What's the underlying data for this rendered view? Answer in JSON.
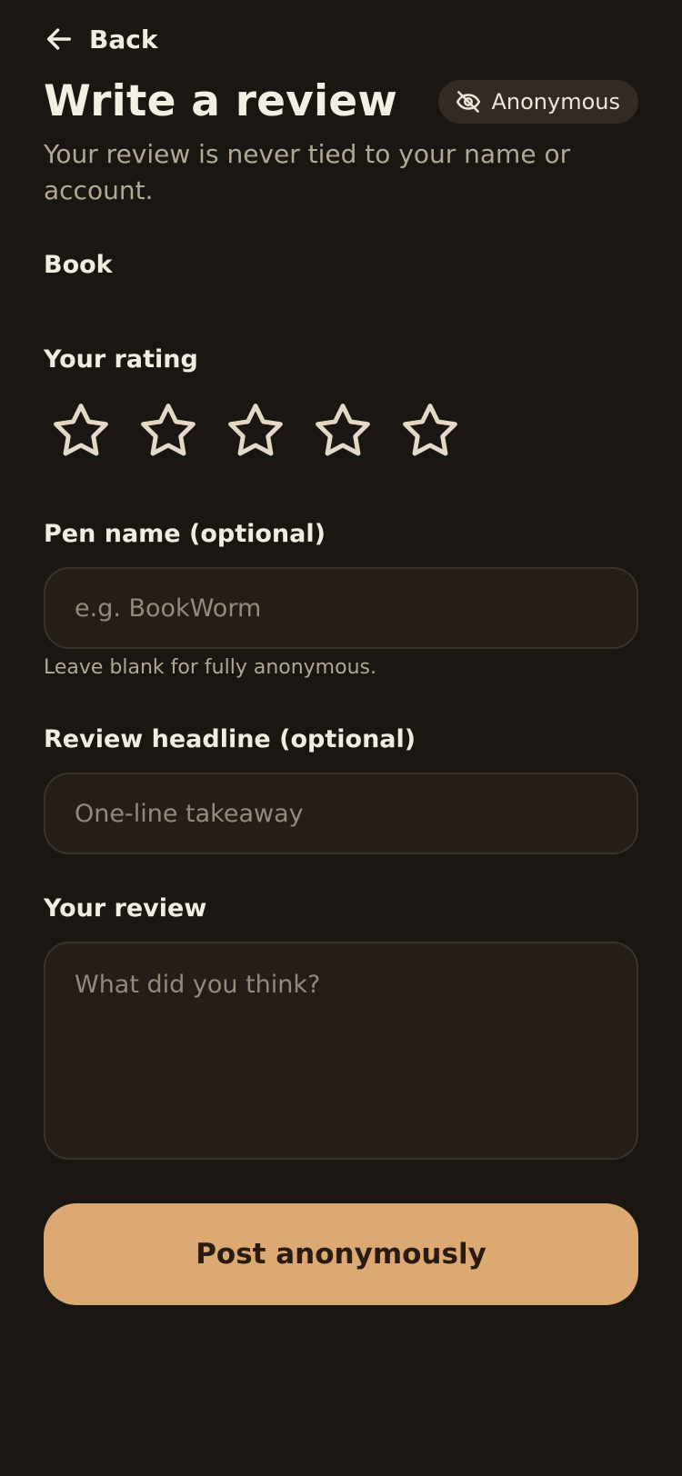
{
  "header": {
    "back_label": "Back",
    "title": "Write a review",
    "badge_label": "Anonymous",
    "subtitle": "Your review is never tied to your name or account."
  },
  "book": {
    "label": "Book"
  },
  "rating": {
    "label": "Your rating",
    "max": 5,
    "value": 0
  },
  "pen_name": {
    "label": "Pen name (optional)",
    "placeholder": "e.g. BookWorm",
    "value": "",
    "hint": "Leave blank for fully anonymous."
  },
  "headline": {
    "label": "Review headline (optional)",
    "placeholder": "One-line takeaway",
    "value": ""
  },
  "review": {
    "label": "Your review",
    "placeholder": "What did you think?",
    "value": ""
  },
  "submit": {
    "label": "Post anonymously"
  },
  "colors": {
    "background": "#1a1612",
    "accent": "#dca972",
    "star_outline": "#e4d9c8"
  }
}
